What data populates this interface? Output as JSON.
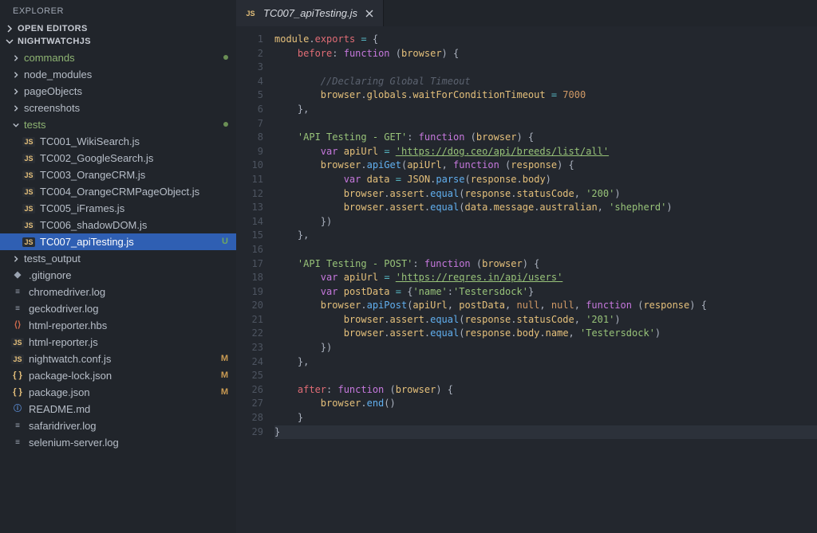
{
  "sidebar": {
    "title": "EXPLORER",
    "sections": {
      "openEditors": {
        "label": "OPEN EDITORS",
        "expanded": false
      },
      "project": {
        "label": "NIGHTWATCHJS",
        "expanded": true
      }
    },
    "tree": [
      {
        "kind": "folder",
        "label": "commands",
        "indent": 1,
        "expanded": false,
        "unsavedDot": true,
        "green": true
      },
      {
        "kind": "folder",
        "label": "node_modules",
        "indent": 1,
        "expanded": false
      },
      {
        "kind": "folder",
        "label": "pageObjects",
        "indent": 1,
        "expanded": false
      },
      {
        "kind": "folder",
        "label": "screenshots",
        "indent": 1,
        "expanded": false
      },
      {
        "kind": "folder",
        "label": "tests",
        "indent": 1,
        "expanded": true,
        "unsavedDot": true,
        "green": true
      },
      {
        "kind": "file",
        "label": "TC001_WikiSearch.js",
        "indent": 2,
        "icon": "js"
      },
      {
        "kind": "file",
        "label": "TC002_GoogleSearch.js",
        "indent": 2,
        "icon": "js"
      },
      {
        "kind": "file",
        "label": "TC003_OrangeCRM.js",
        "indent": 2,
        "icon": "js"
      },
      {
        "kind": "file",
        "label": "TC004_OrangeCRMPageObject.js",
        "indent": 2,
        "icon": "js"
      },
      {
        "kind": "file",
        "label": "TC005_iFrames.js",
        "indent": 2,
        "icon": "js"
      },
      {
        "kind": "file",
        "label": "TC006_shadowDOM.js",
        "indent": 2,
        "icon": "js"
      },
      {
        "kind": "file",
        "label": "TC007_apiTesting.js",
        "indent": 2,
        "icon": "js",
        "selected": true,
        "status": "U"
      },
      {
        "kind": "folder",
        "label": "tests_output",
        "indent": 1,
        "expanded": false
      },
      {
        "kind": "file",
        "label": ".gitignore",
        "indent": 1,
        "icon": "gitignore"
      },
      {
        "kind": "file",
        "label": "chromedriver.log",
        "indent": 1,
        "icon": "log"
      },
      {
        "kind": "file",
        "label": "geckodriver.log",
        "indent": 1,
        "icon": "log"
      },
      {
        "kind": "file",
        "label": "html-reporter.hbs",
        "indent": 1,
        "icon": "hbs"
      },
      {
        "kind": "file",
        "label": "html-reporter.js",
        "indent": 1,
        "icon": "js"
      },
      {
        "kind": "file",
        "label": "nightwatch.conf.js",
        "indent": 1,
        "icon": "js",
        "status": "M",
        "statusClass": "M"
      },
      {
        "kind": "file",
        "label": "package-lock.json",
        "indent": 1,
        "icon": "json",
        "status": "M",
        "statusClass": "M"
      },
      {
        "kind": "file",
        "label": "package.json",
        "indent": 1,
        "icon": "json",
        "status": "M",
        "statusClass": "M"
      },
      {
        "kind": "file",
        "label": "README.md",
        "indent": 1,
        "icon": "info"
      },
      {
        "kind": "file",
        "label": "safaridriver.log",
        "indent": 1,
        "icon": "log"
      },
      {
        "kind": "file",
        "label": "selenium-server.log",
        "indent": 1,
        "icon": "log"
      }
    ]
  },
  "tabs": [
    {
      "icon": "js",
      "title": "TC007_apiTesting.js",
      "active": true
    }
  ],
  "code": {
    "lines": [
      [
        [
          "id",
          "module"
        ],
        [
          "pun",
          "."
        ],
        [
          "prop",
          "exports"
        ],
        [
          "pun",
          " "
        ],
        [
          "op",
          "="
        ],
        [
          "pun",
          " {"
        ]
      ],
      [
        [
          "pun",
          "    "
        ],
        [
          "prop",
          "before"
        ],
        [
          "pun",
          ": "
        ],
        [
          "kw",
          "function"
        ],
        [
          "pun",
          " ("
        ],
        [
          "id",
          "browser"
        ],
        [
          "pun",
          ") {"
        ]
      ],
      [
        [
          "pun",
          ""
        ]
      ],
      [
        [
          "pun",
          "        "
        ],
        [
          "cm",
          "//Declaring Global Timeout"
        ]
      ],
      [
        [
          "pun",
          "        "
        ],
        [
          "id",
          "browser"
        ],
        [
          "pun",
          "."
        ],
        [
          "id",
          "globals"
        ],
        [
          "pun",
          "."
        ],
        [
          "id",
          "waitForConditionTimeout"
        ],
        [
          "pun",
          " "
        ],
        [
          "op",
          "="
        ],
        [
          "pun",
          " "
        ],
        [
          "num",
          "7000"
        ]
      ],
      [
        [
          "pun",
          "    },"
        ]
      ],
      [
        [
          "pun",
          ""
        ]
      ],
      [
        [
          "pun",
          "    "
        ],
        [
          "str",
          "'API Testing - GET'"
        ],
        [
          "pun",
          ": "
        ],
        [
          "kw",
          "function"
        ],
        [
          "pun",
          " ("
        ],
        [
          "id",
          "browser"
        ],
        [
          "pun",
          ") {"
        ]
      ],
      [
        [
          "pun",
          "        "
        ],
        [
          "kw",
          "var"
        ],
        [
          "pun",
          " "
        ],
        [
          "id",
          "apiUrl"
        ],
        [
          "pun",
          " "
        ],
        [
          "op",
          "="
        ],
        [
          "pun",
          " "
        ],
        [
          "strlnk",
          "'https://dog.ceo/api/breeds/list/all'"
        ]
      ],
      [
        [
          "pun",
          "        "
        ],
        [
          "id",
          "browser"
        ],
        [
          "pun",
          "."
        ],
        [
          "fn",
          "apiGet"
        ],
        [
          "pun",
          "("
        ],
        [
          "id",
          "apiUrl"
        ],
        [
          "pun",
          ", "
        ],
        [
          "kw",
          "function"
        ],
        [
          "pun",
          " ("
        ],
        [
          "id",
          "response"
        ],
        [
          "pun",
          ") {"
        ]
      ],
      [
        [
          "pun",
          "            "
        ],
        [
          "kw",
          "var"
        ],
        [
          "pun",
          " "
        ],
        [
          "id",
          "data"
        ],
        [
          "pun",
          " "
        ],
        [
          "op",
          "="
        ],
        [
          "pun",
          " "
        ],
        [
          "id",
          "JSON"
        ],
        [
          "pun",
          "."
        ],
        [
          "fn",
          "parse"
        ],
        [
          "pun",
          "("
        ],
        [
          "id",
          "response"
        ],
        [
          "pun",
          "."
        ],
        [
          "id",
          "body"
        ],
        [
          "pun",
          ")"
        ]
      ],
      [
        [
          "pun",
          "            "
        ],
        [
          "id",
          "browser"
        ],
        [
          "pun",
          "."
        ],
        [
          "id",
          "assert"
        ],
        [
          "pun",
          "."
        ],
        [
          "fn",
          "equal"
        ],
        [
          "pun",
          "("
        ],
        [
          "id",
          "response"
        ],
        [
          "pun",
          "."
        ],
        [
          "id",
          "statusCode"
        ],
        [
          "pun",
          ", "
        ],
        [
          "str",
          "'200'"
        ],
        [
          "pun",
          ")"
        ]
      ],
      [
        [
          "pun",
          "            "
        ],
        [
          "id",
          "browser"
        ],
        [
          "pun",
          "."
        ],
        [
          "id",
          "assert"
        ],
        [
          "pun",
          "."
        ],
        [
          "fn",
          "equal"
        ],
        [
          "pun",
          "("
        ],
        [
          "id",
          "data"
        ],
        [
          "pun",
          "."
        ],
        [
          "id",
          "message"
        ],
        [
          "pun",
          "."
        ],
        [
          "id",
          "australian"
        ],
        [
          "pun",
          ", "
        ],
        [
          "str",
          "'shepherd'"
        ],
        [
          "pun",
          ")"
        ]
      ],
      [
        [
          "pun",
          "        })"
        ]
      ],
      [
        [
          "pun",
          "    },"
        ]
      ],
      [
        [
          "pun",
          ""
        ]
      ],
      [
        [
          "pun",
          "    "
        ],
        [
          "str",
          "'API Testing - POST'"
        ],
        [
          "pun",
          ": "
        ],
        [
          "kw",
          "function"
        ],
        [
          "pun",
          " ("
        ],
        [
          "id",
          "browser"
        ],
        [
          "pun",
          ") {"
        ]
      ],
      [
        [
          "pun",
          "        "
        ],
        [
          "kw",
          "var"
        ],
        [
          "pun",
          " "
        ],
        [
          "id",
          "apiUrl"
        ],
        [
          "pun",
          " "
        ],
        [
          "op",
          "="
        ],
        [
          "pun",
          " "
        ],
        [
          "strlnk",
          "'https://reqres.in/api/users'"
        ]
      ],
      [
        [
          "pun",
          "        "
        ],
        [
          "kw",
          "var"
        ],
        [
          "pun",
          " "
        ],
        [
          "id",
          "postData"
        ],
        [
          "pun",
          " "
        ],
        [
          "op",
          "="
        ],
        [
          "pun",
          " {"
        ],
        [
          "str",
          "'name'"
        ],
        [
          "pun",
          ":"
        ],
        [
          "str",
          "'Testersdock'"
        ],
        [
          "pun",
          "}"
        ]
      ],
      [
        [
          "pun",
          "        "
        ],
        [
          "id",
          "browser"
        ],
        [
          "pun",
          "."
        ],
        [
          "fn",
          "apiPost"
        ],
        [
          "pun",
          "("
        ],
        [
          "id",
          "apiUrl"
        ],
        [
          "pun",
          ", "
        ],
        [
          "id",
          "postData"
        ],
        [
          "pun",
          ", "
        ],
        [
          "const",
          "null"
        ],
        [
          "pun",
          ", "
        ],
        [
          "const",
          "null"
        ],
        [
          "pun",
          ", "
        ],
        [
          "kw",
          "function"
        ],
        [
          "pun",
          " ("
        ],
        [
          "id",
          "response"
        ],
        [
          "pun",
          ") {"
        ]
      ],
      [
        [
          "pun",
          "            "
        ],
        [
          "id",
          "browser"
        ],
        [
          "pun",
          "."
        ],
        [
          "id",
          "assert"
        ],
        [
          "pun",
          "."
        ],
        [
          "fn",
          "equal"
        ],
        [
          "pun",
          "("
        ],
        [
          "id",
          "response"
        ],
        [
          "pun",
          "."
        ],
        [
          "id",
          "statusCode"
        ],
        [
          "pun",
          ", "
        ],
        [
          "str",
          "'201'"
        ],
        [
          "pun",
          ")"
        ]
      ],
      [
        [
          "pun",
          "            "
        ],
        [
          "id",
          "browser"
        ],
        [
          "pun",
          "."
        ],
        [
          "id",
          "assert"
        ],
        [
          "pun",
          "."
        ],
        [
          "fn",
          "equal"
        ],
        [
          "pun",
          "("
        ],
        [
          "id",
          "response"
        ],
        [
          "pun",
          "."
        ],
        [
          "id",
          "body"
        ],
        [
          "pun",
          "."
        ],
        [
          "id",
          "name"
        ],
        [
          "pun",
          ", "
        ],
        [
          "str",
          "'Testersdock'"
        ],
        [
          "pun",
          ")"
        ]
      ],
      [
        [
          "pun",
          "        })"
        ]
      ],
      [
        [
          "pun",
          "    },"
        ]
      ],
      [
        [
          "pun",
          ""
        ]
      ],
      [
        [
          "pun",
          "    "
        ],
        [
          "prop",
          "after"
        ],
        [
          "pun",
          ": "
        ],
        [
          "kw",
          "function"
        ],
        [
          "pun",
          " ("
        ],
        [
          "id",
          "browser"
        ],
        [
          "pun",
          ") {"
        ]
      ],
      [
        [
          "pun",
          "        "
        ],
        [
          "id",
          "browser"
        ],
        [
          "pun",
          "."
        ],
        [
          "fn",
          "end"
        ],
        [
          "pun",
          "()"
        ]
      ],
      [
        [
          "pun",
          "    }"
        ]
      ],
      [
        [
          "pun",
          "}"
        ]
      ]
    ],
    "currentLine": 29
  },
  "icons": {
    "js": "JS",
    "json": "{ }",
    "log": "≡",
    "hbs": "⟨⟩",
    "gitignore": "◆",
    "info": "ⓘ"
  }
}
